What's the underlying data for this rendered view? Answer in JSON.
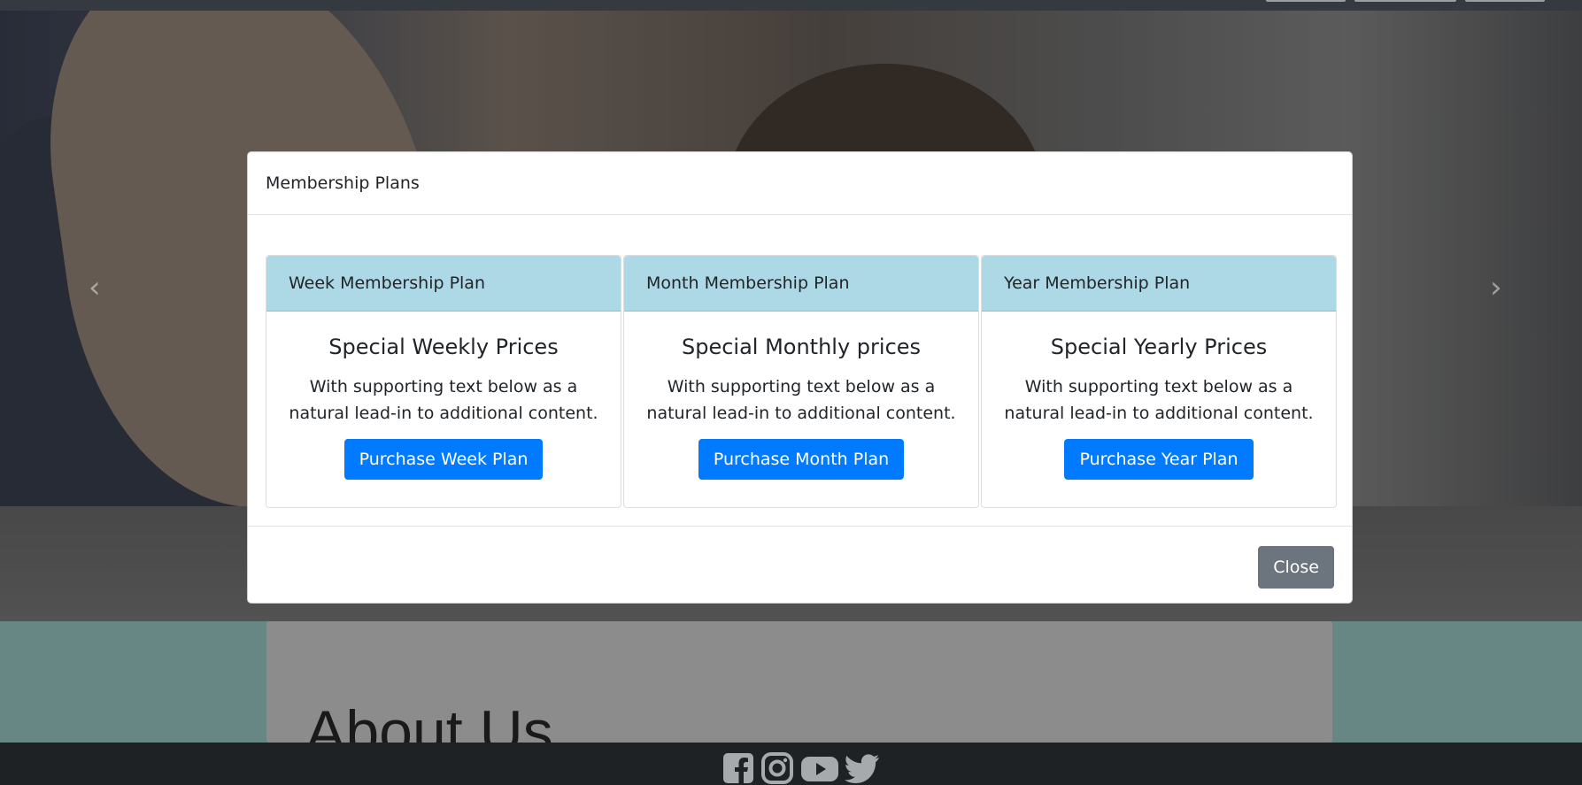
{
  "modal": {
    "title": "Membership Plans",
    "close_label": "Close",
    "plans": [
      {
        "header": "Week Membership Plan",
        "title": "Special Weekly Prices",
        "text": "With supporting text below as a natural lead-in to additional content.",
        "button": "Purchase Week Plan"
      },
      {
        "header": "Month Membership Plan",
        "title": "Special Monthly prices",
        "text": "With supporting text below as a natural lead-in to additional content.",
        "button": "Purchase Month Plan"
      },
      {
        "header": "Year Membership Plan",
        "title": "Special Yearly Prices",
        "text": "With supporting text below as a natural lead-in to additional content.",
        "button": "Purchase Year Plan"
      }
    ]
  },
  "carousel": {
    "prev_icon": "‹",
    "next_icon": "›"
  },
  "about": {
    "title": "About Us"
  },
  "footer": {
    "social_icons": [
      "facebook-icon",
      "instagram-icon",
      "youtube-icon",
      "twitter-icon"
    ]
  },
  "colors": {
    "card_header_bg": "#add8e6",
    "primary": "#007bff",
    "secondary": "#6c757d",
    "about_bg": "#668784"
  }
}
